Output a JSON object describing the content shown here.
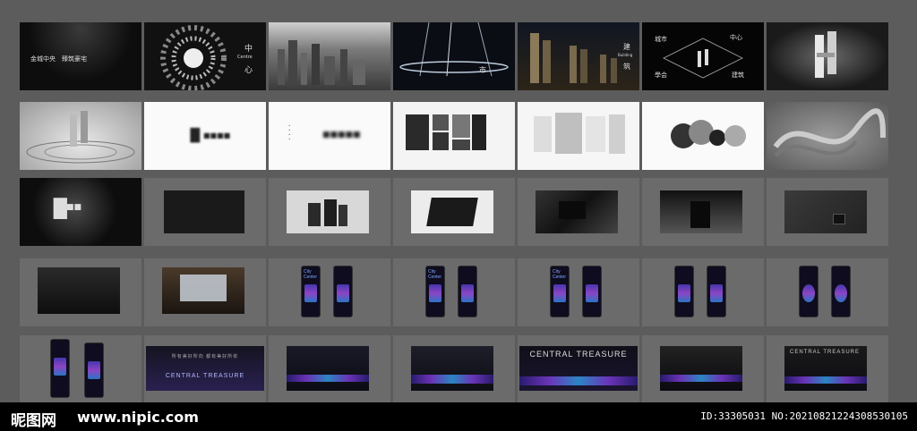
{
  "tiles": [
    {
      "theme": "dark",
      "caption": "金城中央　臻筑豪宅"
    },
    {
      "theme": "dark",
      "caption": ""
    },
    {
      "theme": "dark",
      "caption": ""
    },
    {
      "theme": "dark",
      "caption": ""
    },
    {
      "theme": "dark",
      "caption": ""
    },
    {
      "theme": "dark",
      "caption": ""
    },
    {
      "theme": "dark",
      "caption": ""
    }
  ],
  "row1": {
    "t2_text_a": "中",
    "t2_text_b": "Centre",
    "t2_text_c": "心",
    "t4_text": "市",
    "t5_text_a": "建",
    "t5_text_b": "Building",
    "t5_text_c": "筑",
    "t6_city": "城市",
    "t6_center": "中心",
    "t6_hall": "學会",
    "t6_build": "建筑"
  },
  "row5": {
    "banner_text": "CENTRAL TREASURE",
    "banner_text_cn": "所有美好所向  都有美好所依"
  },
  "phones": {
    "label": "City Center"
  },
  "footer": {
    "brand": "昵图网",
    "url": "www.nipic.com",
    "id": "ID:33305031 NO:20210821224308530105"
  },
  "colors": {
    "background": "#5c5c5c",
    "accent": "#7a3ad3",
    "footer": "#000000"
  }
}
